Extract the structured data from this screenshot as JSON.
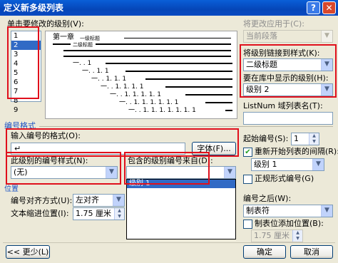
{
  "window": {
    "title": "定义新多级列表",
    "help_glyph": "?",
    "close_glyph": "✕"
  },
  "level_select": {
    "label": "单击要修改的级别(V):",
    "levels": [
      "1",
      "2",
      "3",
      "4",
      "5",
      "6",
      "7",
      "8",
      "9"
    ],
    "selected_index": 1
  },
  "preview": {
    "line1_prefix": "第一章",
    "line1_text": "一级标题",
    "line2_text": "二级标题",
    "dot_rows": [
      "一. . 1",
      "一. . 1. 1",
      "一. . 1. 1. 1",
      "一. . 1. 1. 1. 1",
      "一. . 1. 1. 1. 1. 1",
      "一. . 1. 1. 1. 1. 1. 1",
      "一. . 1. 1. 1. 1. 1. 1. 1"
    ]
  },
  "apply_to": {
    "label": "将更改应用于(C):",
    "value": "当前段落"
  },
  "link_style": {
    "label": "将级别链接到样式(K):",
    "value": "二级标题"
  },
  "gallery_level": {
    "label": "要在库中显示的级别(H):",
    "value": "级别 2"
  },
  "listnum": {
    "label": "ListNum 域列表名(T):",
    "value": ""
  },
  "number_format_section": {
    "title": "编号格式",
    "format_label": "输入编号的格式(O):",
    "format_value": "↵",
    "font_button": "字体(F)...",
    "style_label": "此级别的编号样式(N):",
    "style_value": "(无)",
    "include_label": "包含的级别编号来自(D):",
    "include_value": "",
    "include_option": "级别 1"
  },
  "position_section": {
    "title": "位置",
    "align_label": "编号对齐方式(U):",
    "align_value": "左对齐",
    "indent_label": "文本缩进位置(I):",
    "indent_value": "1.75 厘米"
  },
  "start_at": {
    "label": "起始编号(S):",
    "value": "1"
  },
  "restart": {
    "label": "重新开始列表的间隔(R):",
    "checked": true,
    "value": "级别 1"
  },
  "legal": {
    "label": "正规形式编号(G)",
    "checked": false
  },
  "follow": {
    "label": "编号之后(W):",
    "value": "制表符"
  },
  "tab_stop": {
    "label": "制表位添加位置(B):",
    "checked": false,
    "value": "1.75 厘米"
  },
  "buttons": {
    "less": "<< 更少(L)",
    "ok": "确定",
    "cancel": "取消"
  },
  "colors": {
    "title_bar": "#0546b8",
    "highlight_box": "#e0101c",
    "selection": "#316ac5"
  }
}
